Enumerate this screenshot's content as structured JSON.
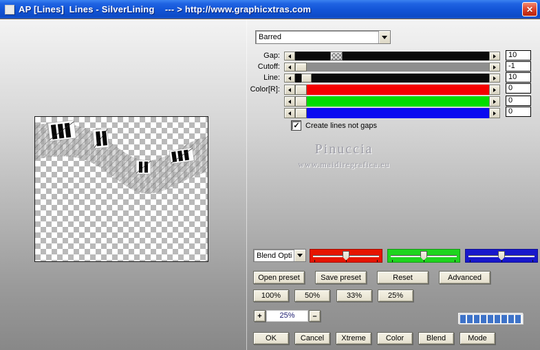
{
  "window": {
    "title": "AP [Lines]  Lines - SilverLining    --- > http://www.graphicxtras.com",
    "close_glyph": "✕"
  },
  "colors": {
    "titlebar_blue": "#1254d6",
    "track_black": "#0a0a0a",
    "track_gray": "#8e8e8e",
    "track_red": "#f40000",
    "track_green": "#00dc00",
    "track_blue": "#0a0af0",
    "blend_red": "#e61400",
    "blend_green": "#1ed51e",
    "blend_blue": "#1818cc",
    "progress_blue": "#3d72c8"
  },
  "preset_select": {
    "value": "Barred"
  },
  "params": {
    "rows": [
      {
        "label": "Gap:",
        "value": "10"
      },
      {
        "label": "Cutoff:",
        "value": "-1"
      },
      {
        "label": "Line:",
        "value": "10"
      },
      {
        "label": "Color[R]:",
        "value": "0"
      },
      {
        "label": "",
        "value": "0"
      },
      {
        "label": "",
        "value": "0"
      }
    ],
    "checkbox_label": "Create lines not gaps",
    "checkbox_checked": true,
    "check_glyph": "✓"
  },
  "watermark": {
    "name": "Pinuccia",
    "site": "www.maidiregrafica.eu"
  },
  "blend": {
    "select_value": "Blend Opti"
  },
  "preset_buttons": [
    "Open preset",
    "Save preset",
    "Reset",
    "Advanced"
  ],
  "zoom_buttons": [
    "100%",
    "50%",
    "33%",
    "25%"
  ],
  "zoom_stepper": {
    "plus": "+",
    "value": "25%",
    "minus": "–"
  },
  "progress": {
    "filled": 9,
    "total": 10
  },
  "action_buttons": [
    "OK",
    "Cancel",
    "Xtreme",
    "Color",
    "Blend",
    "Mode"
  ]
}
